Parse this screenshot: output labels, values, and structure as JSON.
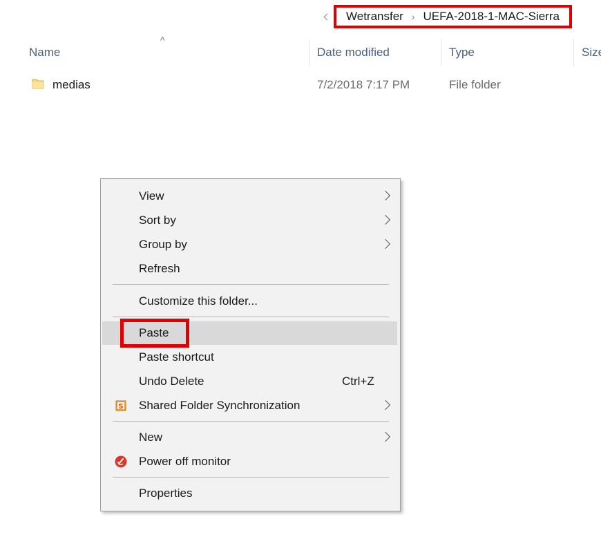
{
  "breadcrumb": {
    "items": [
      "Wetransfer",
      "UEFA-2018-1-MAC-Sierra"
    ],
    "separator": "›"
  },
  "columns": {
    "name": "Name",
    "date_modified": "Date modified",
    "type": "Type",
    "size": "Size"
  },
  "files": [
    {
      "name": "medias",
      "date_modified": "7/2/2018 7:17 PM",
      "type": "File folder",
      "icon": "folder-icon"
    }
  ],
  "context_menu": {
    "items": [
      {
        "label": "View",
        "submenu": true
      },
      {
        "label": "Sort by",
        "submenu": true
      },
      {
        "label": "Group by",
        "submenu": true
      },
      {
        "label": "Refresh"
      },
      {
        "label": "Customize this folder..."
      },
      {
        "label": "Paste",
        "highlighted": true
      },
      {
        "label": "Paste shortcut"
      },
      {
        "label": "Undo Delete",
        "shortcut": "Ctrl+Z"
      },
      {
        "label": "Shared Folder Synchronization",
        "submenu": true,
        "icon": "sync-s-icon"
      },
      {
        "label": "New",
        "submenu": true
      },
      {
        "label": "Power off monitor",
        "icon": "power-off-icon"
      },
      {
        "label": "Properties"
      }
    ]
  },
  "colors": {
    "highlight_border": "#e00000",
    "menu_background": "#f2f2f2",
    "menu_highlight": "#d9d9d9",
    "folder_yellow": "#f8d775"
  }
}
